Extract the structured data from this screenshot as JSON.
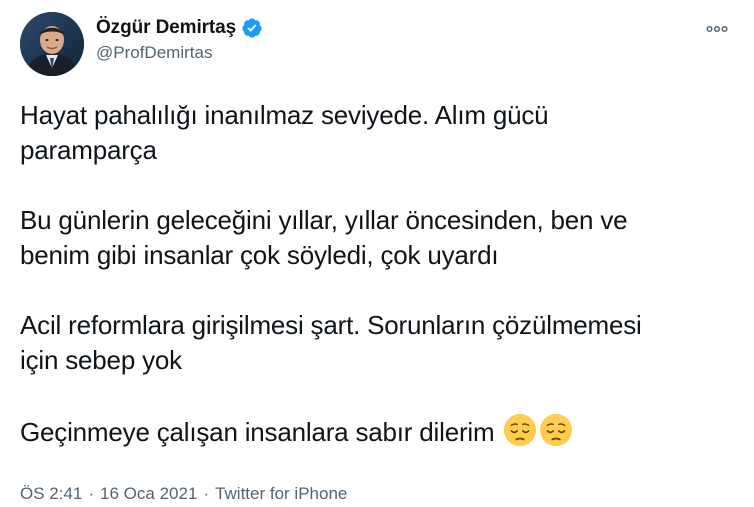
{
  "author": {
    "display_name": "Özgür Demirtaş",
    "handle": "@ProfDemirtas",
    "verified": true,
    "avatar_icon": "profile-photo"
  },
  "icons": {
    "verified": "verified-badge-icon",
    "more": "more-options-icon",
    "emoji": "pensive-face-emoji"
  },
  "colors": {
    "verified_blue": "#1d9bf0",
    "text_primary": "#0f1419",
    "text_secondary": "#536471"
  },
  "tweet": {
    "paragraphs": [
      {
        "lines": [
          "Hayat pahalılığı inanılmaz seviyede. Alım gücü",
          "paramparça"
        ]
      },
      {
        "lines": [
          "Bu günlerin geleceğini yıllar, yıllar öncesinden, ben ve",
          "benim gibi insanlar çok söyledi, çok uyardı"
        ]
      },
      {
        "lines": [
          "Acil reformlara girişilmesi şart. Sorunların çözülmemesi",
          "için sebep yok"
        ]
      },
      {
        "lines": [
          "Geçinmeye çalışan insanlara sabır dilerim"
        ],
        "emojis": [
          "😔",
          "😔"
        ]
      }
    ]
  },
  "meta": {
    "time": "ÖS 2:41",
    "date": "16 Oca 2021",
    "source": "Twitter for iPhone",
    "separator": "·"
  }
}
